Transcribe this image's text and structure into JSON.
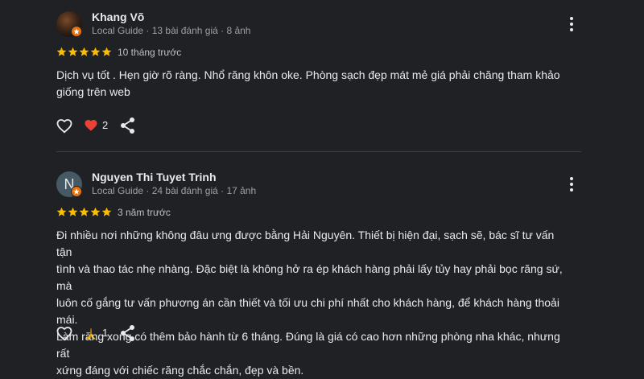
{
  "reviews": [
    {
      "name": "Khang Võ",
      "avatar_letter": "",
      "meta": "Local Guide · 13 bài đánh giá · 8 ảnh",
      "rating": 5,
      "time": "10 tháng trước",
      "text_lines": [
        "Dịch vụ tốt . Hẹn giờ rõ ràng. Nhổ răng khôn oke. Phòng sạch đẹp mát mẻ giá phải chăng tham khảo",
        "giống trên web"
      ],
      "reaction_icon": "heart-icon",
      "reaction_count": "2"
    },
    {
      "name": "Nguyen Thi Tuyet Trinh",
      "avatar_letter": "N",
      "meta": "Local Guide · 24 bài đánh giá · 17 ảnh",
      "rating": 5,
      "time": "3 năm trước",
      "text_lines": [
        "Đi nhiều nơi những không đâu ưng được bằng Hải Nguyên. Thiết bị hiện đại, sạch sẽ, bác sĩ tư vấn tận",
        "tình và thao tác nhẹ nhàng. Đặc biệt là không hở ra ép khách hàng phải lấy tủy hay phải bọc răng sứ, mà",
        "luôn cố gắng tư vấn phương án cần thiết và tối ưu chi phí nhất cho khách hàng, để khách hàng thoải mái.",
        "Làm răng xong có thêm bảo hành từ 6 tháng. Đúng là giá có cao hơn những phòng nha khác, nhưng rất",
        "xứng đáng với chiếc răng chắc chắn, đẹp và bền."
      ],
      "reaction_icon": "folded-hands-icon",
      "reaction_count": "1"
    }
  ],
  "colors": {
    "background": "#202124",
    "star": "#fbbc04",
    "heart": "#ea4335",
    "badge": "#e8710a"
  }
}
